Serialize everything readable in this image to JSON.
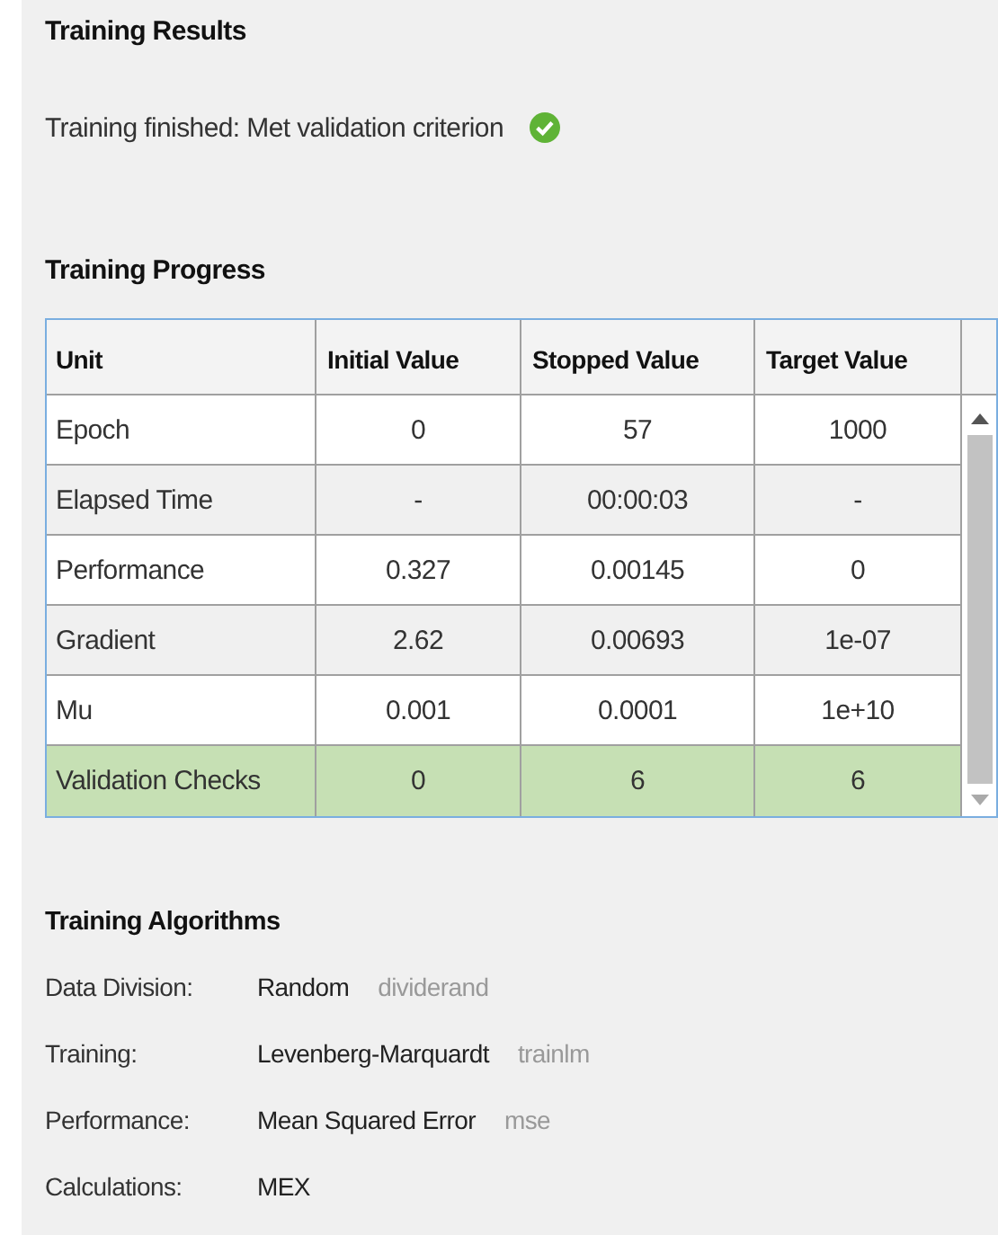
{
  "results": {
    "title": "Training Results",
    "status": "Training finished: Met validation criterion",
    "success": true
  },
  "progress": {
    "title": "Training Progress",
    "columns": [
      "Unit",
      "Initial Value",
      "Stopped Value",
      "Target Value"
    ],
    "rows": [
      {
        "cells": [
          "Epoch",
          "0",
          "57",
          "1000"
        ],
        "highlighted": false
      },
      {
        "cells": [
          "Elapsed Time",
          "-",
          "00:00:03",
          "-"
        ],
        "highlighted": false
      },
      {
        "cells": [
          "Performance",
          "0.327",
          "0.00145",
          "0"
        ],
        "highlighted": false
      },
      {
        "cells": [
          "Gradient",
          "2.62",
          "0.00693",
          "1e-07"
        ],
        "highlighted": false
      },
      {
        "cells": [
          "Mu",
          "0.001",
          "0.0001",
          "1e+10"
        ],
        "highlighted": false
      },
      {
        "cells": [
          "Validation Checks",
          "0",
          "6",
          "6"
        ],
        "highlighted": true
      }
    ]
  },
  "algorithms": {
    "title": "Training Algorithms",
    "items": [
      {
        "label": "Data Division:",
        "value": "Random",
        "function": "dividerand"
      },
      {
        "label": "Training:",
        "value": "Levenberg-Marquardt",
        "function": "trainlm"
      },
      {
        "label": "Performance:",
        "value": "Mean Squared Error",
        "function": "mse"
      },
      {
        "label": "Calculations:",
        "value": "MEX"
      }
    ]
  }
}
